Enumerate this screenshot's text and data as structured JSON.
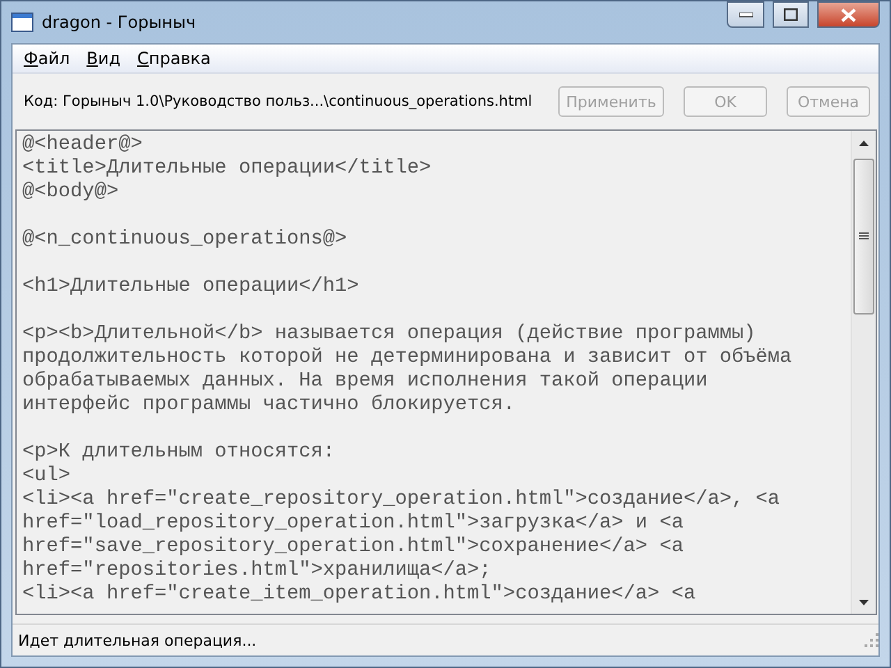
{
  "window": {
    "title": "dragon - Горыныч"
  },
  "menu": [
    {
      "label": "Файл"
    },
    {
      "label": "Вид"
    },
    {
      "label": "Справка"
    }
  ],
  "toolbar": {
    "path": "Код: Горыныч 1.0\\Руководство польз...\\continuous_operations.html",
    "buttons": [
      {
        "label": "Применить",
        "disabled": true
      },
      {
        "label": "OK",
        "disabled": true
      },
      {
        "label": "Отмена",
        "disabled": true
      }
    ]
  },
  "editor": {
    "blocks": [
      [
        "@<header@>",
        "<title>Длительные операции</title>",
        "@<body@>"
      ],
      [
        "@<n_continuous_operations@>"
      ],
      [
        "<h1>Длительные операции</h1>"
      ],
      [
        "<p><b>Длительной</b> называется операция (действие программы)",
        "продолжительность которой не детерминирована и зависит от объёма",
        "обрабатываемых данных. На время исполнения такой операции",
        "интерфейс программы частично блокируется."
      ],
      [
        "<p>К длительным относятся:",
        "<ul>",
        "<li><a href=\"create_repository_operation.html\">создание</a>, <a",
        "href=\"load_repository_operation.html\">загрузка</a> и <a",
        "href=\"save_repository_operation.html\">сохранение</a> <a",
        "href=\"repositories.html\">хранилища</a>;",
        "<li><a href=\"create_item_operation.html\">создание</a> <a"
      ]
    ]
  },
  "status_bar": {
    "text": "Идет длительная операция..."
  }
}
